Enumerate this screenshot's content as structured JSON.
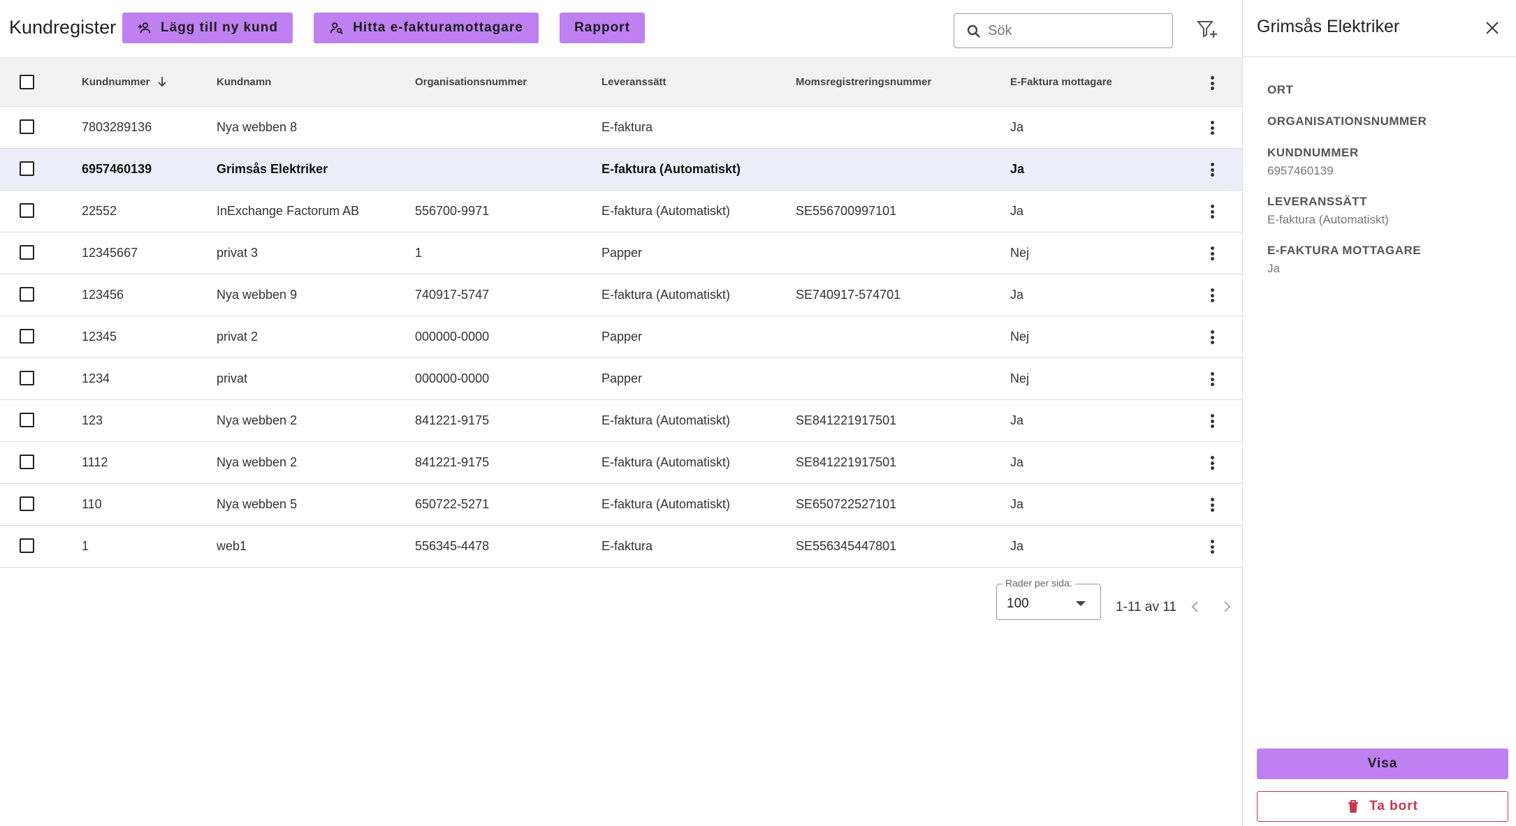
{
  "app": {
    "title": "Kundregister"
  },
  "toolbar": {
    "add_label": "Lägg till ny kund",
    "find_label": "Hitta e-fakturamottagare",
    "report_label": "Rapport",
    "search_placeholder": "Sök",
    "accent_color": "#bf80f2"
  },
  "table": {
    "columns": [
      "Kundnummer",
      "Kundnamn",
      "Organisationsnummer",
      "Leveranssätt",
      "Momsregistreringsnummer",
      "E-Faktura mottagare"
    ],
    "sort": {
      "column": "Kundnummer",
      "direction": "descending"
    },
    "selected_row": 1,
    "rows": [
      {
        "kundnummer": "7803289136",
        "kundnamn": "Nya webben 8",
        "orgnr": "",
        "leverans": "E-faktura",
        "moms": "",
        "efaktura": "Ja"
      },
      {
        "kundnummer": "6957460139",
        "kundnamn": "Grimsås Elektriker",
        "orgnr": "",
        "leverans": "E-faktura (Automatiskt)",
        "moms": "",
        "efaktura": "Ja"
      },
      {
        "kundnummer": "22552",
        "kundnamn": "InExchange Factorum AB",
        "orgnr": "556700-9971",
        "leverans": "E-faktura (Automatiskt)",
        "moms": "SE556700997101",
        "efaktura": "Ja"
      },
      {
        "kundnummer": "12345667",
        "kundnamn": "privat 3",
        "orgnr": "1",
        "leverans": "Papper",
        "moms": "",
        "efaktura": "Nej"
      },
      {
        "kundnummer": "123456",
        "kundnamn": "Nya webben 9",
        "orgnr": "740917-5747",
        "leverans": "E-faktura (Automatiskt)",
        "moms": "SE740917-574701",
        "efaktura": "Ja"
      },
      {
        "kundnummer": "12345",
        "kundnamn": "privat 2",
        "orgnr": "000000-0000",
        "leverans": "Papper",
        "moms": "",
        "efaktura": "Nej"
      },
      {
        "kundnummer": "1234",
        "kundnamn": "privat",
        "orgnr": "000000-0000",
        "leverans": "Papper",
        "moms": "",
        "efaktura": "Nej"
      },
      {
        "kundnummer": "123",
        "kundnamn": "Nya webben 2",
        "orgnr": "841221-9175",
        "leverans": "E-faktura (Automatiskt)",
        "moms": "SE841221917501",
        "efaktura": "Ja"
      },
      {
        "kundnummer": "1112",
        "kundnamn": "Nya webben 2",
        "orgnr": "841221-9175",
        "leverans": "E-faktura (Automatiskt)",
        "moms": "SE841221917501",
        "efaktura": "Ja"
      },
      {
        "kundnummer": "110",
        "kundnamn": "Nya webben 5",
        "orgnr": "650722-5271",
        "leverans": "E-faktura (Automatiskt)",
        "moms": "SE650722527101",
        "efaktura": "Ja"
      },
      {
        "kundnummer": "1",
        "kundnamn": "web1",
        "orgnr": "556345-4478",
        "leverans": "E-faktura",
        "moms": "SE556345447801",
        "efaktura": "Ja"
      }
    ]
  },
  "pagination": {
    "rows_per_page_label": "Rader per sida:",
    "rows_per_page": "100",
    "range_text": "1-11 av 11"
  },
  "panel": {
    "title": "Grimsås Elektriker",
    "fields": [
      {
        "label": "ORT",
        "value": ""
      },
      {
        "label": "ORGANISATIONSNUMMER",
        "value": ""
      },
      {
        "label": "KUNDNUMMER",
        "value": "6957460139"
      },
      {
        "label": "LEVERANSSÄTT",
        "value": "E-faktura (Automatiskt)"
      },
      {
        "label": "E-FAKTURA MOTTAGARE",
        "value": "Ja"
      }
    ],
    "view_label": "Visa",
    "delete_label": "Ta bort",
    "delete_color": "#c9364f"
  },
  "icons": [
    "person-add-icon",
    "person-search-icon",
    "search-icon",
    "filter-add-icon",
    "checkbox-icon",
    "sort-arrow-icon",
    "more-vert-icon",
    "chevron-left-icon",
    "chevron-right-icon",
    "close-icon",
    "trash-icon"
  ]
}
